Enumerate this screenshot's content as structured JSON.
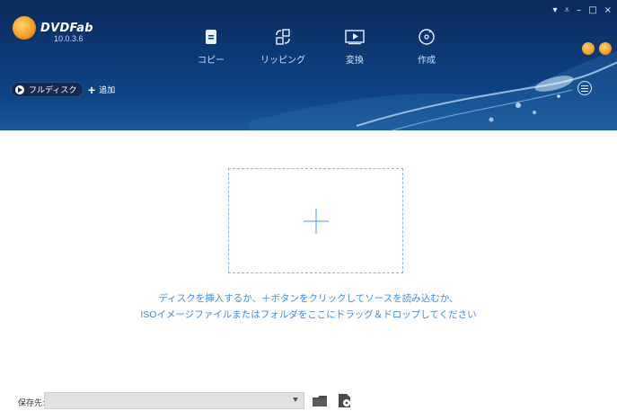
{
  "app": {
    "logo_text": "DVDFab",
    "version": "10.0.3.6"
  },
  "tabs": [
    {
      "label": "コピー",
      "icon": "copy-icon"
    },
    {
      "label": "リッピング",
      "icon": "ripping-icon"
    },
    {
      "label": "変換",
      "icon": "convert-icon"
    },
    {
      "label": "作成",
      "icon": "create-icon"
    }
  ],
  "window_controls": {
    "filter": "▾",
    "more": "⩡",
    "minimize": "–",
    "maximize": "□",
    "close": "×"
  },
  "toolbar": {
    "full_disc_label": "フルディスク",
    "add_label": "追加"
  },
  "dropzone": {
    "hint_line1": "ディスクを挿入するか、＋ボタンをクリックしてソースを読み込むか、",
    "hint_line2": "ISOイメージファイルまたはフォルダをここにドラッグ＆ドロップしてください"
  },
  "bottom": {
    "save_label": "保存先:",
    "save_path_value": ""
  },
  "colors": {
    "header_bg": "#0d3a77",
    "accent_blue": "#3f8dd6",
    "dropzone_border": "#8fb6dc"
  }
}
